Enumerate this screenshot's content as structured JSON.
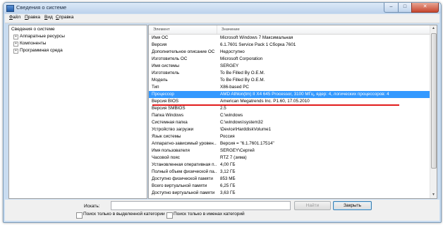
{
  "window": {
    "title": "Сведения о системе",
    "close_glyph": "✕",
    "min_glyph": "–",
    "max_glyph": "□"
  },
  "menu": [
    {
      "pre": "",
      "ul": "Ф",
      "post": "айл"
    },
    {
      "pre": "",
      "ul": "П",
      "post": "равка"
    },
    {
      "pre": "",
      "ul": "В",
      "post": "ид"
    },
    {
      "pre": "",
      "ul": "С",
      "post": "правка"
    }
  ],
  "tree": {
    "root": "Сведения о системе",
    "items": [
      "Аппаратные ресурсы",
      "Компоненты",
      "Программная среда"
    ],
    "expander": "+"
  },
  "table": {
    "headers": [
      "Элемент",
      "Значение"
    ],
    "rows": [
      [
        "Имя ОС",
        "Microsoft Windows 7 Максимальная"
      ],
      [
        "Версия",
        "6.1.7601 Service Pack 1 Сборка 7601"
      ],
      [
        "Дополнительное описание ОС",
        "Недоступно"
      ],
      [
        "Изготовитель ОС",
        "Microsoft Corporation"
      ],
      [
        "Имя системы",
        "SERGEY"
      ],
      [
        "Изготовитель",
        "To Be Filled By O.E.M."
      ],
      [
        "Модель",
        "To Be Filled By O.E.M."
      ],
      [
        "Тип",
        "X86-based PC"
      ],
      [
        "Процессор",
        "AMD Athlon(tm) II X4 645 Processor, 3100 МГц, ядер: 4, логических процессоров: 4"
      ],
      [
        "Версия BIOS",
        "American Megatrends Inc. P1.60, 17.05.2010"
      ],
      [
        "Версия SMBIOS",
        "2.5"
      ],
      [
        "Папка Windows",
        "C:\\windows"
      ],
      [
        "Системная папка",
        "C:\\windows\\system32"
      ],
      [
        "Устройство загрузки",
        "\\Device\\HarddiskVolume1"
      ],
      [
        "Язык системы",
        "Россия"
      ],
      [
        "Аппаратно-зависимый уровен...",
        "Версия = \"6.1.7601.17514\""
      ],
      [
        "Имя пользователя",
        "SERGEY\\Сергей"
      ],
      [
        "Часовой пояс",
        "RTZ 7 (зима)"
      ],
      [
        "Установленная оперативная п...",
        "4,00 ГБ"
      ],
      [
        "Полный объем физической па...",
        "3,12 ГБ"
      ],
      [
        "Доступно физической памяти",
        "853 МБ"
      ],
      [
        "Всего виртуальной памяти",
        "6,25 ГБ"
      ],
      [
        "Доступно виртуальной памяти",
        "3,63 ГБ"
      ]
    ],
    "selected_index": 8
  },
  "search": {
    "label": "Искать:",
    "value": "",
    "find_next": "Найти",
    "close": "Закрыть",
    "option_selected_category": "Поиск только в выделенной категории",
    "option_category_names": "Поиск только в именах категорий"
  },
  "colors": {
    "selection": "#3399ff",
    "highlight_line": "#e21b1b"
  }
}
